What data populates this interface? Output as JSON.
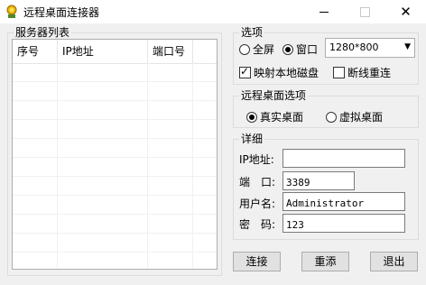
{
  "window": {
    "title": "远程桌面连接器",
    "minimize_icon": "minimize-icon",
    "maximize_icon": "maximize-icon",
    "close_icon": "close-icon",
    "close_glyph": "✕"
  },
  "server_list": {
    "group_label": "服务器列表",
    "columns": [
      "序号",
      "IP地址",
      "端口号"
    ],
    "rows": []
  },
  "options": {
    "group_label": "选项",
    "fullscreen_label": "全屏",
    "window_label": "窗口",
    "mode_selected": "窗口",
    "resolution_value": "1280*800",
    "map_disk_label": "映射本地磁盘",
    "map_disk_checked": true,
    "reconnect_label": "断线重连",
    "reconnect_checked": false
  },
  "desktop_options": {
    "group_label": "远程桌面选项",
    "real_label": "真实桌面",
    "virtual_label": "虚拟桌面",
    "selected": "真实桌面"
  },
  "details": {
    "group_label": "详细",
    "ip_label": "IP地址:",
    "ip_value": "",
    "port_label": "端　口:",
    "port_value": "3389",
    "user_label": "用户名:",
    "user_value": "Administrator",
    "password_label": "密　码:",
    "password_value": "123"
  },
  "buttons": {
    "connect": "连接",
    "add": "重添",
    "exit": "退出"
  }
}
